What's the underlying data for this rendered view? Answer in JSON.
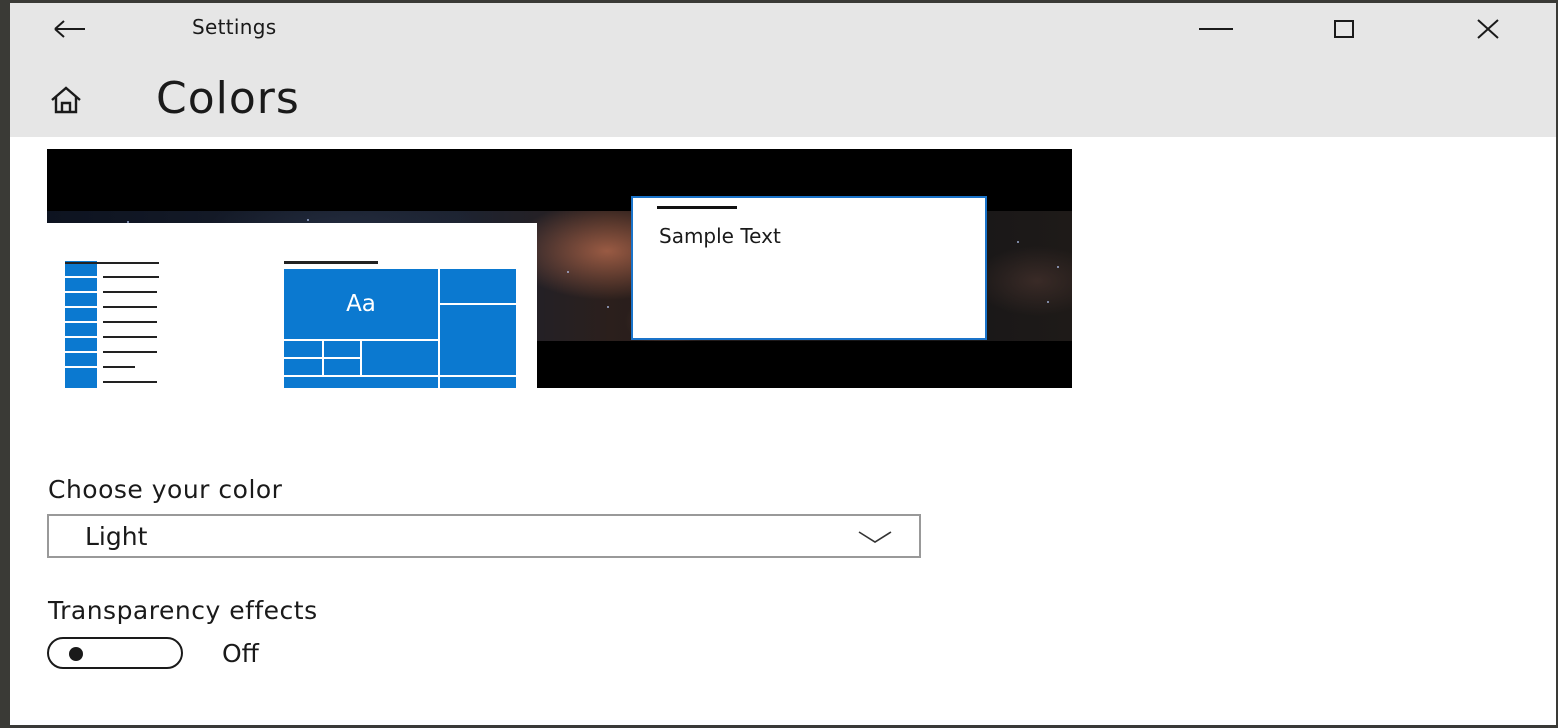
{
  "window": {
    "title": "Settings",
    "controls": {
      "back": "back-arrow-icon",
      "minimize": "minimize-icon",
      "maximize": "maximize-icon",
      "close": "close-icon"
    }
  },
  "page": {
    "home_icon": "home-icon",
    "title": "Colors"
  },
  "preview": {
    "tile_label": "Aa",
    "sample_text": "Sample Text"
  },
  "color_section": {
    "label": "Choose your color",
    "selected": "Light"
  },
  "transparency": {
    "label": "Transparency effects",
    "state_label": "Off",
    "enabled": false
  },
  "colors": {
    "accent": "#0b79d0",
    "titlebar": "#e6e6e6"
  }
}
